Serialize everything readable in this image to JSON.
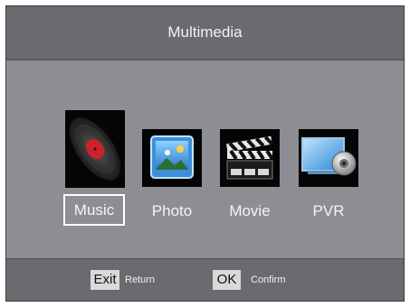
{
  "header": {
    "title": "Multimedia"
  },
  "menu": {
    "items": [
      {
        "label": "Music",
        "icon": "vinyl-record-icon",
        "selected": true
      },
      {
        "label": "Photo",
        "icon": "photo-frame-icon",
        "selected": false
      },
      {
        "label": "Movie",
        "icon": "clapperboard-icon",
        "selected": false
      },
      {
        "label": "PVR",
        "icon": "dvd-recorder-icon",
        "selected": false
      }
    ]
  },
  "footer": {
    "exit_key": "Exit",
    "exit_label": "Return",
    "ok_key": "OK",
    "ok_label": "Confirm"
  },
  "colors": {
    "panel": "#8c8e93",
    "bars": "#6a6b6f",
    "text": "#f4f4f4"
  }
}
